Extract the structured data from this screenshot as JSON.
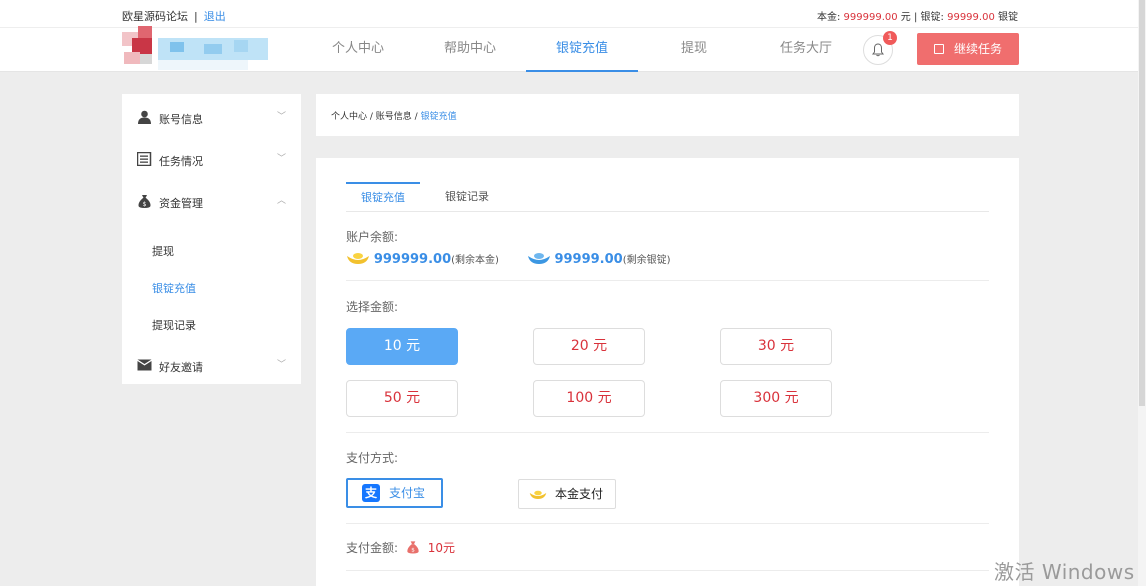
{
  "topbar": {
    "site_name": "欧星源码论坛",
    "separator": "|",
    "logout": "退出",
    "principal_label": "本金:",
    "principal_value": "999999.00",
    "principal_unit": "元",
    "ingot_label": "银锭:",
    "ingot_value": "99999.00",
    "ingot_unit": "银锭"
  },
  "nav": {
    "items": [
      "个人中心",
      "帮助中心",
      "银锭充值",
      "提现",
      "任务大厅"
    ],
    "active_index": 2,
    "notification_count": "1",
    "continue_button": "继续任务"
  },
  "sidebar": {
    "items": [
      {
        "label": "账号信息",
        "icon": "user-icon"
      },
      {
        "label": "任务情况",
        "icon": "list-icon"
      },
      {
        "label": "资金管理",
        "icon": "money-bag-icon"
      },
      {
        "label": "好友邀请",
        "icon": "envelope-icon"
      }
    ],
    "sub_items": [
      "提现",
      "银锭充值",
      "提现记录"
    ],
    "active_sub": 1
  },
  "breadcrumb": {
    "part1": "个人中心",
    "part2": "账号信息",
    "current": "银锭充值",
    "sep": " / "
  },
  "tabs": [
    "银锭充值",
    "银锭记录"
  ],
  "balance": {
    "label": "账户余额:",
    "principal_amount": "999999.00",
    "principal_note": "(剩余本金)",
    "ingot_amount": "99999.00",
    "ingot_note": "(剩余银锭)"
  },
  "amount": {
    "label": "选择金额:",
    "options": [
      "10 元",
      "20 元",
      "30 元",
      "50 元",
      "100 元",
      "300 元"
    ],
    "selected_index": 0
  },
  "payment": {
    "label": "支付方式:",
    "alipay_icon_glyph": "支",
    "alipay": "支付宝",
    "principal_pay": "本金支付"
  },
  "total": {
    "label": "支付金额:",
    "value": "10元"
  },
  "watermark": "激活 Windows",
  "colors": {
    "accent": "#3a8ee6",
    "danger": "#d9323b",
    "continue_btn": "#f06e6e",
    "selected_amount": "#5aa9f5"
  }
}
